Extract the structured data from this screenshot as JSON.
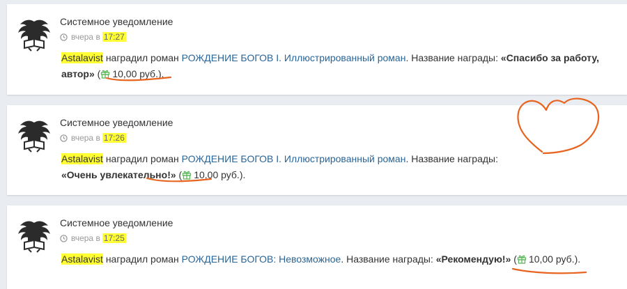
{
  "notifications": [
    {
      "title": "Системное уведомление",
      "time_prefix": "вчера в",
      "time": "17:27",
      "user": "Astalavist",
      "action": "наградил роман",
      "novel": "РОЖДЕНИЕ БОГОВ I. Иллюстрированный роман",
      "award_prefix": ". Название награды:",
      "award": "«Спасибо за работу, автор»",
      "amount": "10,00 руб."
    },
    {
      "title": "Системное уведомление",
      "time_prefix": "вчера в",
      "time": "17:26",
      "user": "Astalavist",
      "action": "наградил роман",
      "novel": "РОЖДЕНИЕ БОГОВ I. Иллюстрированный роман",
      "award_prefix": ". Название награды:",
      "award": "«Очень увлекательно!»",
      "amount": "10,00 руб."
    },
    {
      "title": "Системное уведомление",
      "time_prefix": "вчера в",
      "time": "17:25",
      "user": "Astalavist",
      "action": "наградил роман",
      "novel": "РОЖДЕНИЕ БОГОВ: Невозможное",
      "award_prefix": ". Название награды:",
      "award": "«Рекомендую!»",
      "amount": "10,00 руб."
    }
  ],
  "colors": {
    "highlight": "#ffff33",
    "link": "#2a6496",
    "gift": "#5cb85c",
    "annotation": "#e8641e"
  },
  "icons": {
    "avatar": "eagle-emblem-icon",
    "clock": "clock-icon",
    "gift": "gift-icon"
  }
}
